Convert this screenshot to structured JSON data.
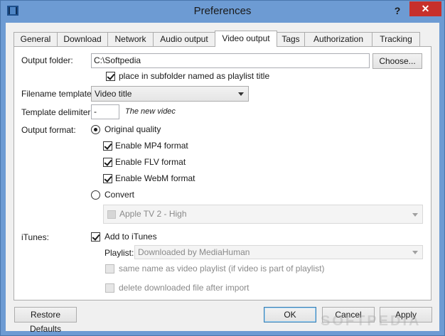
{
  "window": {
    "title": "Preferences",
    "help_glyph": "?",
    "close_glyph": "✕"
  },
  "tabs": [
    {
      "label": "General"
    },
    {
      "label": "Download"
    },
    {
      "label": "Network"
    },
    {
      "label": "Audio output"
    },
    {
      "label": "Video output",
      "active": true
    },
    {
      "label": "Tags"
    },
    {
      "label": "Authorization"
    },
    {
      "label": "Tracking"
    }
  ],
  "video_output": {
    "output_folder_label": "Output folder:",
    "output_folder_value": "C:\\Softpedia",
    "choose_button": "Choose...",
    "subfolder_checkbox": {
      "label": "place in subfolder named as playlist title",
      "checked": true
    },
    "filename_template_label": "Filename template:",
    "filename_template_value": "Video title",
    "template_delimiter_label": "Template delimiter:",
    "template_delimiter_value": "-",
    "template_preview": "The new videc",
    "output_format_label": "Output format:",
    "original_quality": {
      "label": "Original quality",
      "selected": true
    },
    "enable_mp4": {
      "label": "Enable MP4 format",
      "checked": true
    },
    "enable_flv": {
      "label": "Enable FLV format",
      "checked": true
    },
    "enable_webm": {
      "label": "Enable WebM format",
      "checked": true
    },
    "convert": {
      "label": "Convert",
      "selected": false
    },
    "convert_preset": "Apple TV 2 - High",
    "itunes_label": "iTunes:",
    "add_to_itunes": {
      "label": "Add to iTunes",
      "checked": true
    },
    "playlist_label": "Playlist:",
    "playlist_value": "Downloaded by MediaHuman",
    "same_name_playlist": {
      "label": "same name as video playlist (if video is part of playlist)",
      "checked": false
    },
    "delete_after_import": {
      "label": "delete downloaded file after import",
      "checked": false
    }
  },
  "footer": {
    "restore_defaults": "Restore Defaults",
    "ok": "OK",
    "cancel": "Cancel",
    "apply": "Apply"
  },
  "watermark": "SOFTPEDIA",
  "colors": {
    "titlebar": "#6d9bd3",
    "close_button": "#c7302b",
    "panel_background": "#f0f0f0"
  }
}
